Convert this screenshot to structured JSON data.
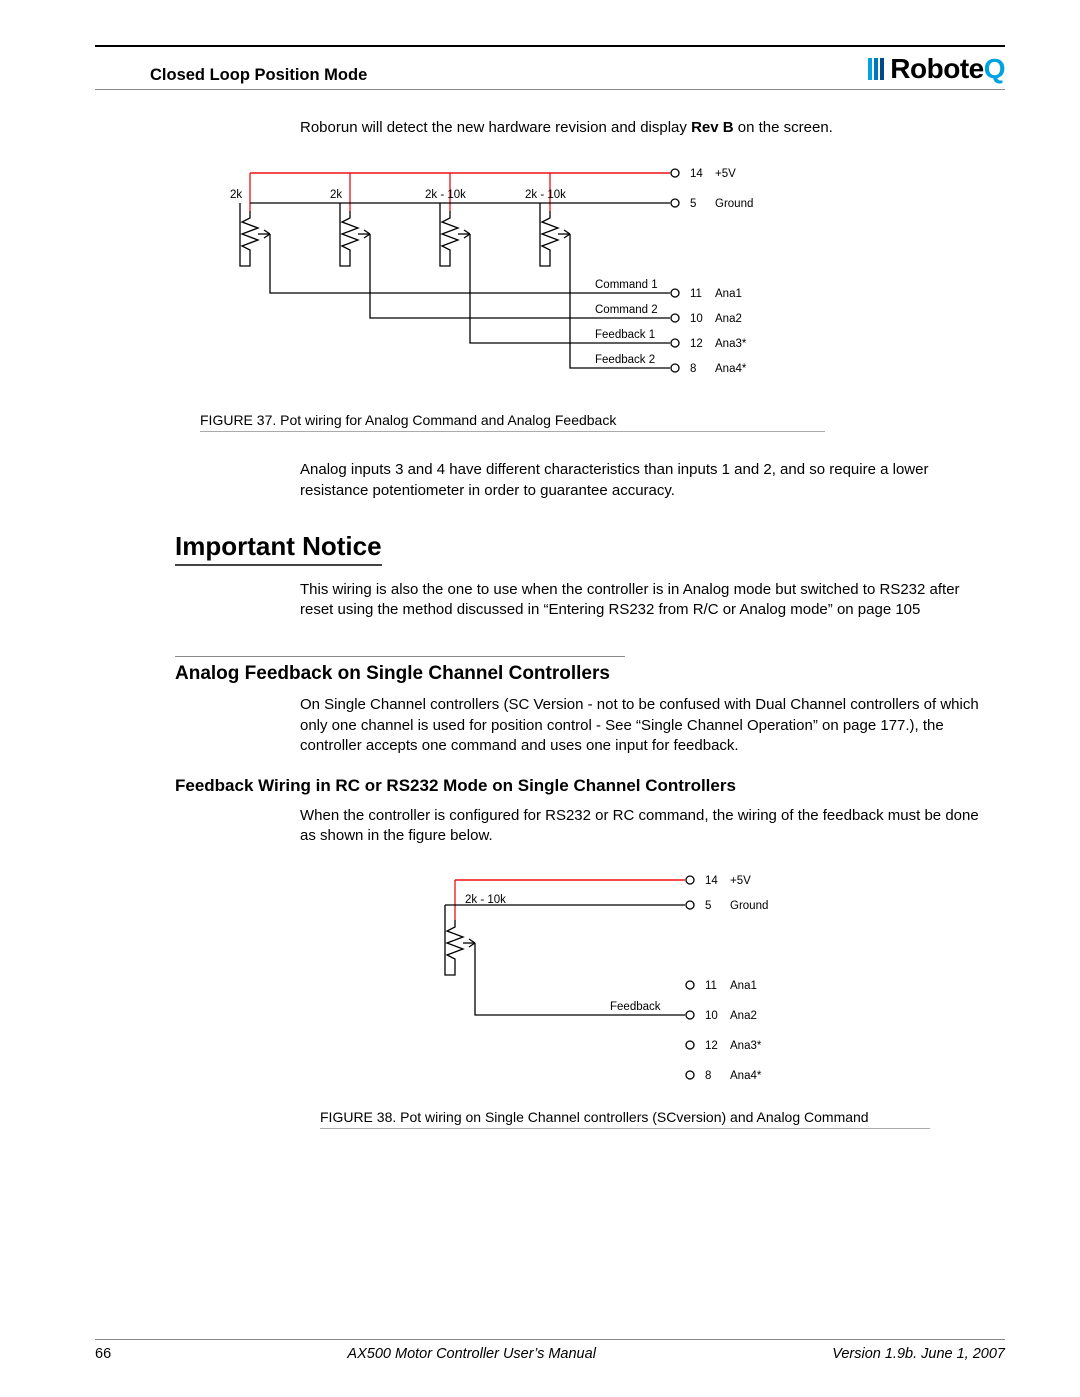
{
  "header": {
    "section_title": "Closed Loop Position Mode",
    "brand": "Robote",
    "brand_suffix": "Q"
  },
  "intro": {
    "line1_a": "Roborun will detect the new hardware revision and display ",
    "line1_bold": "Rev B",
    "line1_b": " on the screen."
  },
  "figure37": {
    "pots": [
      {
        "label": "2k"
      },
      {
        "label": "2k"
      },
      {
        "label": "2k - 10k"
      },
      {
        "label": "2k - 10k"
      }
    ],
    "terminals": [
      {
        "pin": "14",
        "name": "+5V"
      },
      {
        "pin": "5",
        "name": "Ground"
      },
      {
        "pin": "11",
        "name": "Ana1"
      },
      {
        "pin": "10",
        "name": "Ana2"
      },
      {
        "pin": "12",
        "name": "Ana3*"
      },
      {
        "pin": "8",
        "name": "Ana4*"
      }
    ],
    "signals": [
      "Command 1",
      "Command 2",
      "Feedback 1",
      "Feedback 2"
    ],
    "caption": "FIGURE 37.  Pot wiring for Analog Command and Analog Feedback"
  },
  "para_after_fig37": "Analog inputs 3 and 4 have different characteristics than inputs 1 and 2, and so require a lower resistance potentiometer in order to guarantee accuracy.",
  "notice": {
    "heading": "Important Notice",
    "text": "This wiring is also the one to use when the controller is in Analog mode but switched to RS232 after reset using the method discussed in “Entering RS232 from R/C or Analog mode” on page 105"
  },
  "section_analog": {
    "heading": "Analog Feedback on Single Channel Controllers",
    "text": "On Single Channel controllers (SC Version - not to be confused with Dual Channel controllers of which only one channel is used for position control - See “Single Channel Operation” on page 177.), the controller accepts one command and uses one input for feedback."
  },
  "section_feedback": {
    "heading": "Feedback Wiring in RC or RS232 Mode on Single Channel Controllers",
    "text": "When the controller is configured for RS232 or RC command, the wiring of the feedback must be done as shown in the figure below."
  },
  "figure38": {
    "pot_label": "2k - 10k",
    "signal": "Feedback",
    "terminals": [
      {
        "pin": "14",
        "name": "+5V"
      },
      {
        "pin": "5",
        "name": "Ground"
      },
      {
        "pin": "11",
        "name": "Ana1"
      },
      {
        "pin": "10",
        "name": "Ana2"
      },
      {
        "pin": "12",
        "name": "Ana3*"
      },
      {
        "pin": "8",
        "name": "Ana4*"
      }
    ],
    "caption": "FIGURE 38.  Pot wiring on Single Channel controllers (SCversion) and Analog Command"
  },
  "footer": {
    "page": "66",
    "center": "AX500 Motor Controller User’s Manual",
    "right": "Version 1.9b. June 1, 2007"
  }
}
